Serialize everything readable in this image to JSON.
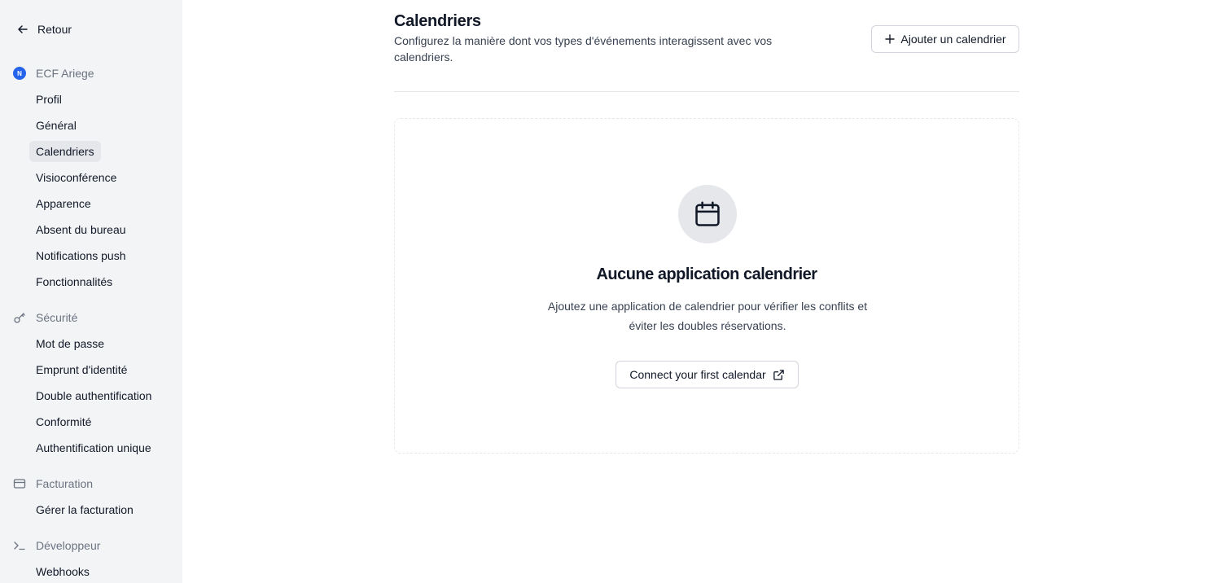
{
  "sidebar": {
    "back_label": "Retour",
    "org": {
      "badge": "N",
      "name": "ECF Ariege",
      "badge_color": "#2563eb"
    },
    "org_items": [
      {
        "label": "Profil"
      },
      {
        "label": "Général"
      },
      {
        "label": "Calendriers",
        "active": true
      },
      {
        "label": "Visioconférence"
      },
      {
        "label": "Apparence"
      },
      {
        "label": "Absent du bureau"
      },
      {
        "label": "Notifications push"
      },
      {
        "label": "Fonctionnalités"
      }
    ],
    "security": {
      "title": "Sécurité",
      "icon": "key-icon",
      "items": [
        {
          "label": "Mot de passe"
        },
        {
          "label": "Emprunt d'identité"
        },
        {
          "label": "Double authentification"
        },
        {
          "label": "Conformité"
        },
        {
          "label": "Authentification unique"
        }
      ]
    },
    "billing": {
      "title": "Facturation",
      "icon": "credit-card-icon",
      "items": [
        {
          "label": "Gérer la facturation"
        }
      ]
    },
    "developer": {
      "title": "Développeur",
      "icon": "terminal-icon",
      "items": [
        {
          "label": "Webhooks"
        }
      ]
    }
  },
  "main": {
    "title": "Calendriers",
    "description": "Configurez la manière dont vos types d'événements interagissent avec vos calendriers.",
    "add_button_label": "Ajouter un calendrier",
    "empty_state": {
      "icon": "calendar-icon",
      "title": "Aucune application calendrier",
      "description": "Ajoutez une application de calendrier pour vérifier les conflits et éviter les doubles réservations.",
      "button_label": "Connect your first calendar",
      "button_icon": "external-link-icon"
    }
  }
}
